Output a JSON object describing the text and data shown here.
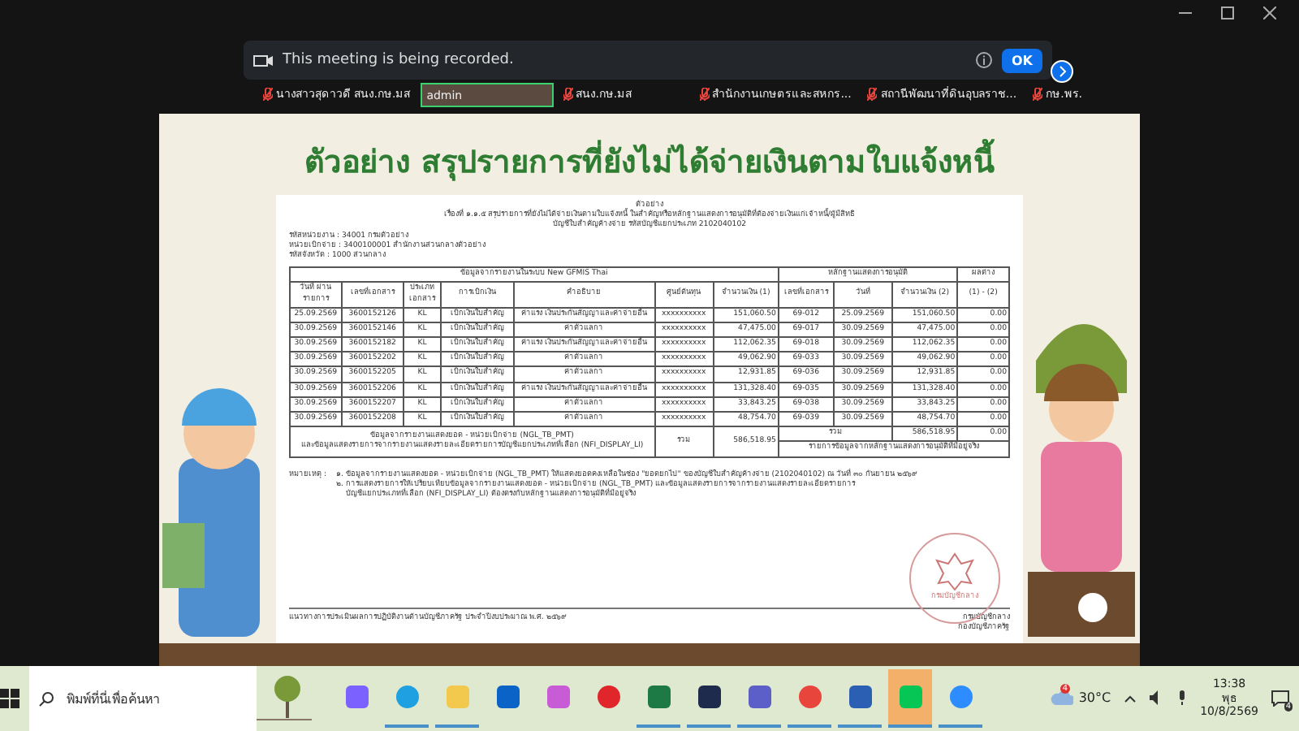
{
  "meeting": {
    "participants": [
      {
        "name": "นางสาวสุดาวดี สนง.กษ.มส",
        "muted": true,
        "speaking": false
      },
      {
        "name": "admin",
        "muted": false,
        "speaking": true
      },
      {
        "name": "สนง.กษ.มส",
        "muted": true,
        "speaking": false
      },
      {
        "name": "สำนักงานเกษตรและสหกร...",
        "muted": true,
        "speaking": false
      },
      {
        "name": "สถานีพัฒนาที่ดินอุบลราช...",
        "muted": true,
        "speaking": false
      },
      {
        "name": "กษ.พร.",
        "muted": true,
        "speaking": false
      }
    ],
    "recording_banner": {
      "message": "This meeting is being recorded.",
      "button": "OK"
    }
  },
  "slide": {
    "title": "ตัวอย่าง สรุปรายการที่ยังไม่ได้จ่ายเงินตามใบแจ้งหนี้",
    "document": {
      "heading": [
        "ตัวอย่าง",
        "เรื่องที่ ๑.๑.๕ สรุปรายการที่ยังไม่ได้จ่ายเงินตามใบแจ้งหนี้ ในสำคัญหรือหลักฐานแสดงการอนุมัติที่ต้องจ่ายเงินแก่เจ้าหนี้/ผู้มีสิทธิ",
        "บัญชีใบสำคัญค้างจ่าย รหัสบัญชีแยกประเภท 2102040102"
      ],
      "info": [
        "รหัสหน่วยงาน : 34001 กรมตัวอย่าง",
        "หน่วยเบิกจ่าย : 3400100001 สำนักงานส่วนกลางตัวอย่าง",
        "รหัสจังหวัด : 1000 ส่วนกลาง"
      ],
      "table": {
        "groups": [
          "ข้อมูลจากรายงานในระบบ New GFMIS Thai",
          "หลักฐานแสดงการอนุมัติ",
          "ผลต่าง"
        ],
        "columns": [
          "วันที่ ผ่านรายการ",
          "เลขที่เอกสาร",
          "ประเภทเอกสาร",
          "การเบิกเงิน",
          "คำอธิบาย",
          "ศูนย์ต้นทุน",
          "จำนวนเงิน (1)",
          "เลขที่เอกสาร",
          "วันที่",
          "จำนวนเงิน (2)",
          "(1) - (2)"
        ],
        "rows": [
          [
            "25.09.2569",
            "3600152126",
            "KL",
            "เบิกเงินใบสำคัญ",
            "ค่าแรง เงินประกันสัญญาและค่าจ่ายอื่น",
            "xxxxxxxxxx",
            "151,060.50",
            "69-012",
            "25.09.2569",
            "151,060.50",
            "0.00"
          ],
          [
            "30.09.2569",
            "3600152146",
            "KL",
            "เบิกเงินใบสำคัญ",
            "ค่าตัวแลกา",
            "xxxxxxxxxx",
            "47,475.00",
            "69-017",
            "30.09.2569",
            "47,475.00",
            "0.00"
          ],
          [
            "30.09.2569",
            "3600152182",
            "KL",
            "เบิกเงินใบสำคัญ",
            "ค่าแรง เงินประกันสัญญาและค่าจ่ายอื่น",
            "xxxxxxxxxx",
            "112,062.35",
            "69-018",
            "30.09.2569",
            "112,062.35",
            "0.00"
          ],
          [
            "30.09.2569",
            "3600152202",
            "KL",
            "เบิกเงินใบสำคัญ",
            "ค่าตัวแลกา",
            "xxxxxxxxxx",
            "49,062.90",
            "69-033",
            "30.09.2569",
            "49,062.90",
            "0.00"
          ],
          [
            "30.09.2569",
            "3600152205",
            "KL",
            "เบิกเงินใบสำคัญ",
            "ค่าตัวแลกา",
            "xxxxxxxxxx",
            "12,931.85",
            "69-036",
            "30.09.2569",
            "12,931.85",
            "0.00"
          ],
          [
            "30.09.2569",
            "3600152206",
            "KL",
            "เบิกเงินใบสำคัญ",
            "ค่าแรง เงินประกันสัญญาและค่าจ่ายอื่น",
            "xxxxxxxxxx",
            "131,328.40",
            "69-035",
            "30.09.2569",
            "131,328.40",
            "0.00"
          ],
          [
            "30.09.2569",
            "3600152207",
            "KL",
            "เบิกเงินใบสำคัญ",
            "ค่าตัวแลกา",
            "xxxxxxxxxx",
            "33,843.25",
            "69-038",
            "30.09.2569",
            "33,843.25",
            "0.00"
          ],
          [
            "30.09.2569",
            "3600152208",
            "KL",
            "เบิกเงินใบสำคัญ",
            "ค่าตัวแลกา",
            "xxxxxxxxxx",
            "48,754.70",
            "69-039",
            "30.09.2569",
            "48,754.70",
            "0.00"
          ]
        ],
        "footer": {
          "source": [
            "ข้อมูลจากรายงานแสดงยอด - หน่วยเบิกจ่าย (NGL_TB_PMT)",
            "และข้อมูลแสดงรายการจากรายงานแสดงรายละเอียดรายการบัญชีแยกประเภทที่เลือก (NFI_DISPLAY_LI)"
          ],
          "total_label": "รวม",
          "total": "586,518.95",
          "evidence_total_label": "รวม",
          "evidence_total": "586,518.95",
          "difference": "0.00",
          "evidence_note": "รายการข้อมูลจากหลักฐานแสดงการอนุมัติที่มีอยู่จริง"
        }
      },
      "notes_label": "หมายเหตุ :",
      "notes": [
        "๑. ข้อมูลจากรายงานแสดงยอด - หน่วยเบิกจ่าย (NGL_TB_PMT) ให้แสดงยอดคงเหลือในช่อง \"ยอดยกไป\" ของบัญชีใบสำคัญค้างจ่าย (2102040102) ณ วันที่ ๓๐ กันยายน ๒๕๖๙",
        "๒. การแสดงรายการให้เปรียบเทียบข้อมูลจากรายงานแสดงยอด - หน่วยเบิกจ่าย (NGL_TB_PMT) และข้อมูลแสดงรายการจากรายงานแสดงรายละเอียดรายการ",
        "บัญชีแยกประเภทที่เลือก (NFI_DISPLAY_LI) ต้องตรงกับหลักฐานแสดงการอนุมัติที่มีอยู่จริง"
      ],
      "stamp": "กรมบัญชีกลาง",
      "footer_left": "แนวทางการประเมินผลการปฏิบัติงานด้านบัญชีภาครัฐ ประจำปีงบประมาณ พ.ศ. ๒๕๖๙",
      "footer_right": [
        "กรมบัญชีกลาง",
        "กองบัญชีภาครัฐ"
      ]
    }
  },
  "taskbar": {
    "search_placeholder": "พิมพ์ที่นี่เพื่อค้นหา",
    "apps": [
      {
        "kind": "copilot",
        "running": false,
        "selected": false
      },
      {
        "kind": "edge",
        "running": true,
        "selected": false
      },
      {
        "kind": "explorer",
        "running": true,
        "selected": false
      },
      {
        "kind": "outlook",
        "running": false,
        "selected": false
      },
      {
        "kind": "photos",
        "running": false,
        "selected": false
      },
      {
        "kind": "opera",
        "running": false,
        "selected": false
      },
      {
        "kind": "excel",
        "running": true,
        "selected": false
      },
      {
        "kind": "editor",
        "running": true,
        "selected": false
      },
      {
        "kind": "teams",
        "running": true,
        "selected": false
      },
      {
        "kind": "chrome",
        "running": true,
        "selected": false
      },
      {
        "kind": "word",
        "running": true,
        "selected": false
      },
      {
        "kind": "line",
        "running": true,
        "selected": true
      },
      {
        "kind": "zoom",
        "running": true,
        "selected": false
      }
    ],
    "temperature": "30°C",
    "weather_alert": "4",
    "time": "13:38",
    "day": "พุธ",
    "date": "10/8/2569",
    "notifications": "4"
  }
}
